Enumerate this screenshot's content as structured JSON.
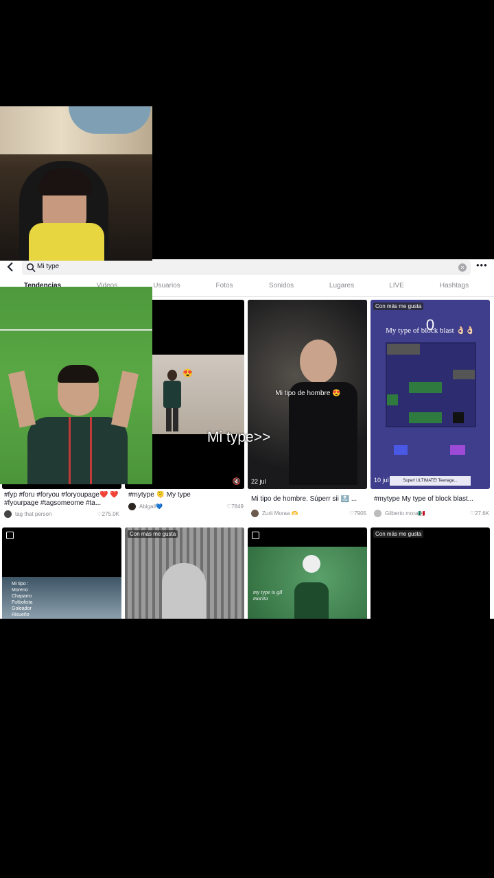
{
  "search": {
    "query": "Mi type",
    "more": "•••"
  },
  "tabs": [
    {
      "label": "Tendencias",
      "active": true
    },
    {
      "label": "Videos"
    },
    {
      "label": "Usuarios"
    },
    {
      "label": "Fotos"
    },
    {
      "label": "Sonidos"
    },
    {
      "label": "Lugares"
    },
    {
      "label": "LIVE"
    },
    {
      "label": "Hashtags"
    }
  ],
  "cards": [
    {
      "caption": "#fyp #foru #foryou #foryoupage❤️ ❤️ #fyourpage #tagsomeome #ta...",
      "author": "tag that person",
      "likes": "275.0K"
    },
    {
      "caption": "#mytype 🫠 My type",
      "author": "Abigail💙",
      "likes": "7849",
      "sticker": "😍"
    },
    {
      "caption": "Mi tipo de hombre. Súperr sii 🔝 ...",
      "author": "Zurii Moraa 🫶",
      "likes": "7905",
      "date": "22 jul",
      "overlay": "Mi tipo de hombre 😍"
    },
    {
      "caption": "#mytype My type of block blast...",
      "author": "Gilberto mora🇲🇽",
      "likes": "27.6K",
      "date": "10 jul",
      "badge": "Con más me gusta",
      "game_title": "My type of block blast 👌🏻👌🏻",
      "score": "0",
      "ad": "Super! ULTIMATE! Teenage..."
    }
  ],
  "row2": [
    {
      "type": "multi",
      "list": [
        "Mi tipo :",
        "Moreno",
        "Chaparro",
        "Futbolista",
        "Goleador",
        "Risueño"
      ]
    },
    {
      "badge": "Con más me gusta"
    },
    {
      "type": "multi",
      "text": "my type is gil morita"
    },
    {
      "badge": "Con más me gusta"
    }
  ],
  "overlay_title": "Mi type>>"
}
